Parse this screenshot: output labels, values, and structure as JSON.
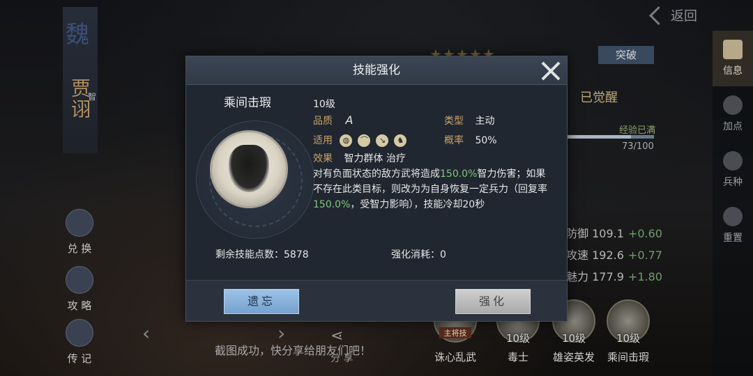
{
  "nav": {
    "back_label": "返回"
  },
  "right_nav": [
    {
      "label": "信息",
      "icon": "scroll-icon"
    },
    {
      "label": "加点",
      "icon": "plus-points-icon"
    },
    {
      "label": "兵种",
      "icon": "troop-icon"
    },
    {
      "label": "重置",
      "icon": "reset-icon"
    }
  ],
  "hero": {
    "kingdom": "魏",
    "name": "贾诩",
    "tag": "智"
  },
  "left_buttons": [
    {
      "label": "兑 换",
      "icon": "exchange-icon"
    },
    {
      "label": "攻 略",
      "icon": "guide-icon"
    },
    {
      "label": "传 记",
      "icon": "biography-icon"
    }
  ],
  "background_info": {
    "stars": "★★★★★",
    "break_label": "突破",
    "awakened": "已觉醒",
    "exp_label": "经验已满",
    "exp_value": "73/100",
    "exp_fraction": 0.73,
    "stats": [
      {
        "name": "防御",
        "value": "109.1",
        "plus": "+0.60"
      },
      {
        "name": "攻速",
        "value": "192.6",
        "plus": "+0.77"
      },
      {
        "name": "魅力",
        "value": "177.9",
        "plus": "+1.80"
      }
    ]
  },
  "skills_row": [
    {
      "name": "诛心乱武",
      "level": "",
      "main_tag": "主将技"
    },
    {
      "name": "毒士",
      "level": "10级",
      "main_tag": ""
    },
    {
      "name": "雄姿英发",
      "level": "10级",
      "main_tag": ""
    },
    {
      "name": "乘间击瑕",
      "level": "10级",
      "main_tag": ""
    }
  ],
  "toast": "截图成功，快分享给朋友们吧！",
  "share_label": "分 享",
  "modal": {
    "title": "技能强化",
    "skill_name": "乘间击瑕",
    "level": "10级",
    "quality_label": "品质",
    "quality_value": "A",
    "type_label": "类型",
    "type_value": "主动",
    "applicable_label": "适用",
    "applicable_icons": [
      "shield-icon",
      "bow-icon",
      "spear-icon",
      "horse-icon"
    ],
    "chance_label": "概率",
    "chance_value": "50%",
    "effect_label": "效果",
    "effect_value": "智力群体 治疗",
    "desc_parts": [
      "对有负面状态的敌方武将造成",
      "150.0%",
      "智力伤害；如果不存在此类目标，则改为为自身恢复一定兵力（回复率",
      "150.0%",
      "，受智力影响），技能冷却20秒"
    ],
    "points_label": "剩余技能点数：",
    "points_value": "5878",
    "cost_label": "强化消耗：",
    "cost_value": "0",
    "forget_label": "遗忘",
    "enhance_label": "强化"
  }
}
